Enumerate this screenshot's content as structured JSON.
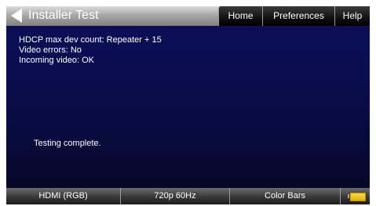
{
  "header": {
    "title": "Installer Test",
    "tabs": [
      {
        "label": "Home"
      },
      {
        "label": "Preferences"
      },
      {
        "label": "Help"
      }
    ]
  },
  "results": {
    "lines": [
      "HDCP max dev count: Repeater + 15",
      "Video errors: No",
      "Incoming video: OK"
    ],
    "status": "Testing complete."
  },
  "statusbar": {
    "items": [
      {
        "label": "HDMI (RGB)"
      },
      {
        "label": "720p 60Hz"
      },
      {
        "label": "Color Bars"
      }
    ],
    "battery_icon": "battery-icon",
    "battery_color": "#ffd84a"
  }
}
